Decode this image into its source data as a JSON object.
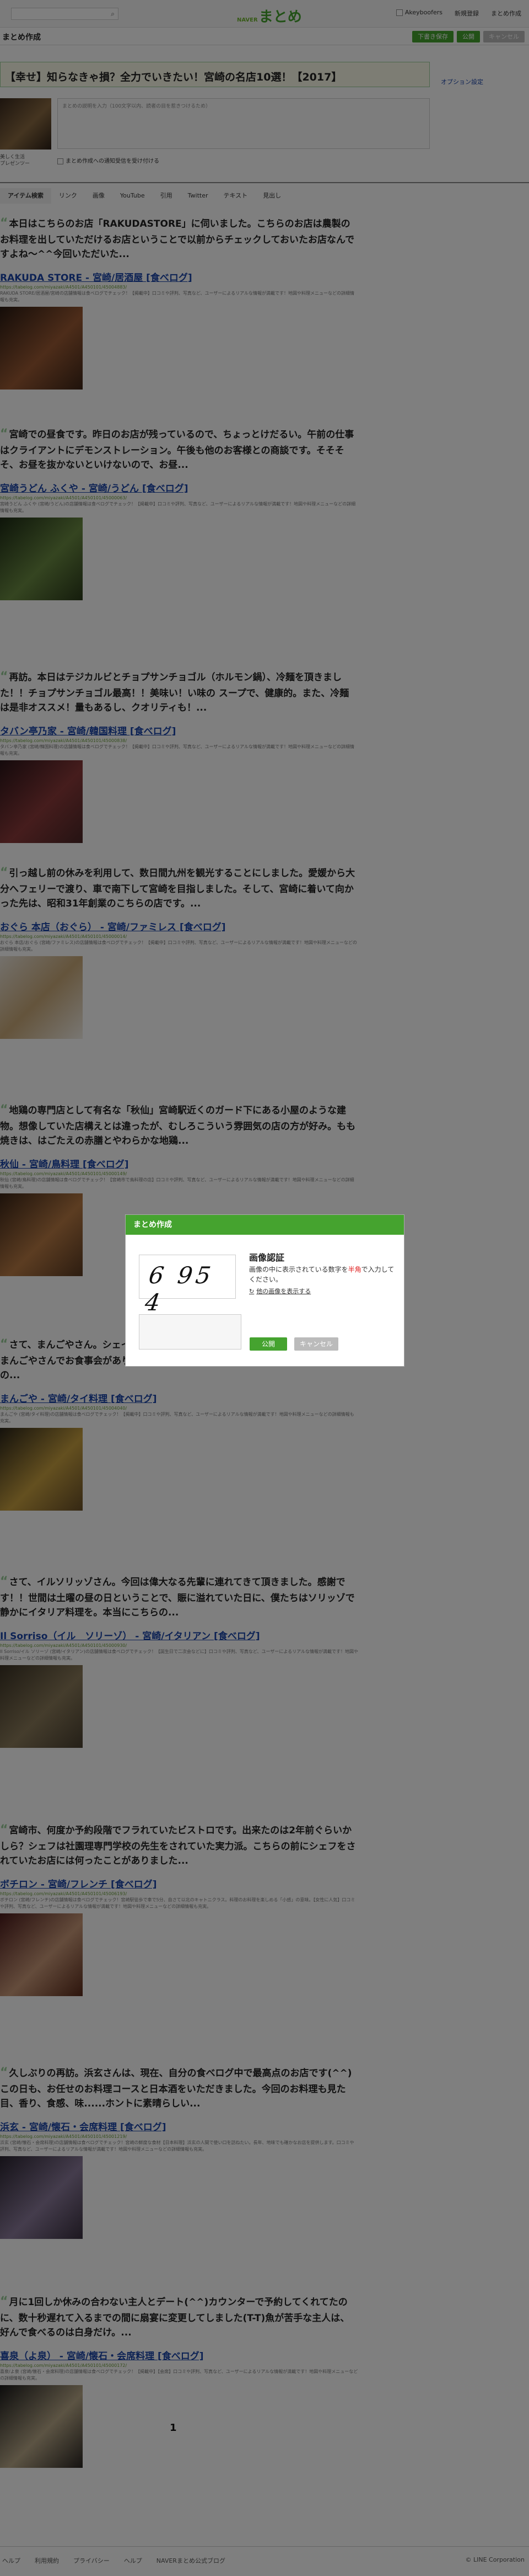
{
  "header": {
    "logo_prefix": "NAVER",
    "logo": "まとめ",
    "links": [
      "Akeyboofers",
      "新規登録",
      "まとめ作成"
    ]
  },
  "subbar": {
    "title": "まとめ作成",
    "buttons": [
      "下書き保存",
      "公開",
      "キャンセル"
    ]
  },
  "matome": {
    "title": "【幸せ】知らなきゃ損？全力でいきたい！宮崎の名店10選！【2017】",
    "side_link": "オプション設定",
    "comment_placeholder": "まとめの説明を入力（100文字以内、読者の目を惹きつけるため）",
    "author_name": "美しく生活\nプレゼンツー",
    "check_label": "まとめ作成への通知受信を受け付ける"
  },
  "tabs": [
    "アイテム検索",
    "リンク",
    "画像",
    "YouTube",
    "引用",
    "Twitter",
    "テキスト",
    "見出し"
  ],
  "sections": [
    {
      "quote": "本日はこちらのお店「RAKUDASTORE」に伺いました。こちらのお店は農製のお料理を出していただけるお店ということで以前からチェックしておいたお店なんですよね〜^^今回いただいた...",
      "title": "RAKUDA STORE - 宮崎/居酒屋 [食べログ]",
      "url": "https://tabelog.com/miyazaki/A4501/A450101/45004883/",
      "desc": "RAKUDA STORE/居酒屋/宮崎の店舗情報は食べログでチェック！【掲載中】口コミや評判、写真など、ユーザーによるリアルな情報が満載です！地図や料理メニューなどの詳細情報も充実。"
    },
    {
      "quote": "宮崎での昼食です。昨日のお店が残っているので、ちょっとけだるい。午前の仕事はクライアントにデモンストレーション。午後も他のお客様との商談です。そそそそ、お昼を抜かないといけないので、お昼...",
      "title": "宮崎うどん ふくや - 宮崎/うどん [食べログ]",
      "url": "https://tabelog.com/miyazaki/A4501/A450101/45000063/",
      "desc": "宮崎うどん ふくや (宮崎/うどん)の店舗情報は食べログでチェック！【掲載中】口コミや評判、写真など、ユーザーによるリアルな情報が満載です！地図や料理メニューなどの詳細情報も充実。"
    },
    {
      "quote": "再訪。本日はテジカルビとチョプサンチョゴル（ホルモン鍋）、冷麺を頂きました！！チョプサンチョゴル最高！！美味い！い味の スープで、健康的。また、冷麺は是非オススメ！量もあるし、クオリティも！...",
      "title": "タバン亭乃家 - 宮崎/韓国料理 [食べログ]",
      "url": "https://tabelog.com/miyazaki/A4501/A450101/45000838/",
      "desc": "タバン亭乃家 (宮崎/韓国料理)の店舗情報は食べログでチェック！【掲載中】口コミや評判、写真など、ユーザーによるリアルな情報が満載です！地図や料理メニューなどの詳細情報も充実。"
    },
    {
      "quote": "引っ越し前の休みを利用して、数日間九州を観光することにしました。愛媛から大分へフェリーで渡り、車で南下して宮崎を目指しました。そして、宮崎に着いて向かった先は、昭和31年創業のこちらの店です。...",
      "title": "おぐら 本店（おぐら） - 宮崎/ファミレス [食べログ]",
      "url": "https://tabelog.com/miyazaki/A4501/A450101/45000014/",
      "desc": "おぐら 本店/おぐら (宮崎/ファミレス)の店舗情報は食べログでチェック！【掲載中】口コミや評判、写真など、ユーザーによるリアルな情報が満載です！地図や料理メニューなどの詳細情報も充実。"
    },
    {
      "quote": "地鶏の専門店として有名な「秋仙」宮崎駅近くのガード下にある小屋のような建物。想像していた店構えとは違ったが、むしろこういう雰囲気の店の方が好み。もも焼きは、はごたえの赤膳とやわらかな地鶏...",
      "title": "秋仙 - 宮崎/鳥料理 [食べログ]",
      "url": "https://tabelog.com/miyazaki/A4501/A450101/45000149/",
      "desc": "秋仙 (宮崎/鳥料理)の店舗情報は食べログでチェック！【宮崎市で鳥料理の店】口コミや評判、写真など、ユーザーによるリアルな情報が満載です！地図や料理メニューなどの詳細情報も充実。"
    },
    {
      "quote": "さて、まんごやさん。シェイノ古賀料理長のスペシャル料理を頂きに伺いました！まんごやさんでお食事会がありました！！ねこやさんのスペシャル料理をありぶし大の...",
      "title": "まんごや - 宮崎/タイ料理 [食べログ]",
      "url": "https://tabelog.com/miyazaki/A4501/A450101/45004040/",
      "desc": "まんごや (宮崎/タイ料理)の店舗情報は食べログでチェック！【掲載中】口コミや評判、写真など、ユーザーによるリアルな情報が満載です！地図や料理メニューなどの詳細情報も充実。"
    },
    {
      "quote": "さて、イルソリッゾさん。今回は偉大なる先輩に連れてきて頂きました。感謝です！！世間は土曜の昼の日ということで、賑に溢れていた日に、僕たちはソリッゾで静かにイタリア料理を。本当にこちらの...",
      "title": "Il Sorriso（イル　ソリーゾ） - 宮崎/イタリアン [食べログ]",
      "url": "https://tabelog.com/miyazaki/A4501/A450101/45000930/",
      "desc": "Il Sorriso/イル ソリーゾ (宮崎/イタリアン)の店舗情報は食べログでチェック！【誕生日で二次会などに】口コミや評判、写真など、ユーザーによるリアルな情報が満載です！地図や料理メニューなどの詳細情報も充実。"
    },
    {
      "quote": "宮崎市、何度か予約段階でフラれていたビストロです。出来たのは2年前ぐらいかしら？シェフは社園理専門学校の先生をされていた実力派。こちらの前にシェフをされていたお店には何ったことがありました...",
      "title": "ボチロン - 宮崎/フレンチ [食べログ]",
      "url": "https://tabelog.com/miyazaki/A4501/A450101/45006193/",
      "desc": "ボチロン (宮崎/フレンチ)の店舗情報は食べログでチェック！宮崎駅徒歩で車で5分、自さて以北のキャトニクラス。料理のお料理を楽しめる「小感」の意味。【女性に人気】口コミや評判、写真など、ユーザーによるリアルな情報が満載です！地図や料理メニューなどの詳細情報も充実。"
    },
    {
      "quote": "久しぶりの再訪。浜玄さんは、現在、自分の食べログ中で最高点のお店です(^^)この日も、お任せのお料理コースと日本酒をいただきました。今回のお料理も見た目、香り、食感、味......ホントに素晴らしい...",
      "title": "浜玄 - 宮崎/懐石・会席料理 [食べログ]",
      "url": "https://tabelog.com/miyazaki/A4501/A450101/45001219/",
      "desc": "浜玄 (宮崎/懐石・会席料理)の店舗情報は食べログでチェック！宮崎の鮮度な食材【日本料理】浜玄の人間で使い口を訪ねたい。長年、地味でも確かなお店を提供します。口コミや評判、写真など、ユーザーによるリアルな情報が満載です！地図や料理メニューなどの詳細情報も充実。"
    },
    {
      "quote": "月に1回しか休みの合わない主人とデート(^^)カウンターで予約してくれてたのに、数十秒遅れて入るまでの間に扇宴に変更してしました(T-T)魚が苦手な主人は、好んで食べるのは白身だけ。...",
      "title": "喜泉（よ泉） - 宮崎/懐石・会席料理 [食べログ]",
      "url": "https://tabelog.com/miyazaki/A4501/A450101/45000172/",
      "desc": "喜泉/よ泉 (宮崎/懐石・会席料理)の店舗情報は食べログでチェック！【掲載中】【会席】口コミや評判、写真など、ユーザーによるリアルな情報が満載です！地図や料理メニューなどの詳細情報も充実。"
    }
  ],
  "pagination": {
    "current": "1"
  },
  "footer": {
    "links": [
      "ヘルプ",
      "利用規約",
      "プライバシー",
      "ヘルプ",
      "NAVERまとめ公式ブログ"
    ],
    "copyright": "© LINE Corporation"
  },
  "modal": {
    "header": "まとめ作成",
    "captcha_text": "6 95 4",
    "title": "画像認証",
    "desc_before": "画像の中に表示されている数字を",
    "desc_red": "半角",
    "desc_after": "で入力してください。",
    "other_image": "他の画像を表示する",
    "ok": "公開",
    "cancel": "キャンセル"
  },
  "colors": {
    "brand": "#45a32f",
    "link": "#1a44a8",
    "overlay": "rgba(0,0,0,0.5)"
  }
}
